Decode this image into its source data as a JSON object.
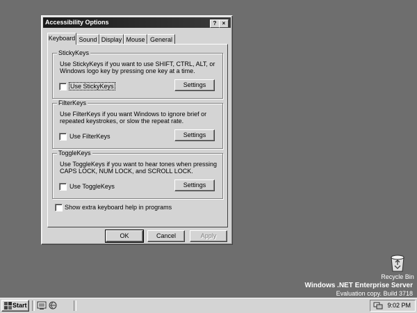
{
  "dialog": {
    "title": "Accessibility Options",
    "help_button": "?",
    "close_button": "×",
    "tabs": [
      "Keyboard",
      "Sound",
      "Display",
      "Mouse",
      "General"
    ],
    "groups": {
      "stickykeys": {
        "legend": "StickyKeys",
        "description": "Use StickyKeys if you want to use SHIFT, CTRL, ALT, or Windows logo key by pressing one key at a time.",
        "checkbox_label": "Use StickyKeys",
        "checked": false,
        "settings_label": "Settings"
      },
      "filterkeys": {
        "legend": "FilterKeys",
        "description": "Use FilterKeys if you want Windows to ignore brief or repeated keystrokes, or slow the repeat rate.",
        "checkbox_label": "Use FilterKeys",
        "checked": false,
        "settings_label": "Settings"
      },
      "togglekeys": {
        "legend": "ToggleKeys",
        "description": "Use ToggleKeys if you want to hear tones when pressing CAPS LOCK, NUM LOCK, and SCROLL LOCK.",
        "checkbox_label": "Use ToggleKeys",
        "checked": false,
        "settings_label": "Settings"
      }
    },
    "extra_help_label": "Show extra keyboard help in programs",
    "ok_label": "OK",
    "cancel_label": "Cancel",
    "apply_label": "Apply"
  },
  "desktop": {
    "recycle_bin_label": "Recycle Bin",
    "watermark_line1": "Windows .NET Enterprise Server",
    "watermark_line2": "Evaluation copy. Build 3718"
  },
  "taskbar": {
    "start_label": "Start",
    "quicklaunch_icons": [
      "desktop-icon",
      "internet-explorer-icon"
    ],
    "clock": "9:02 PM"
  },
  "colors": {
    "desktop": "#6e6e6e",
    "face": "#d4d4d4",
    "titlebar": "#1a1a1a"
  }
}
